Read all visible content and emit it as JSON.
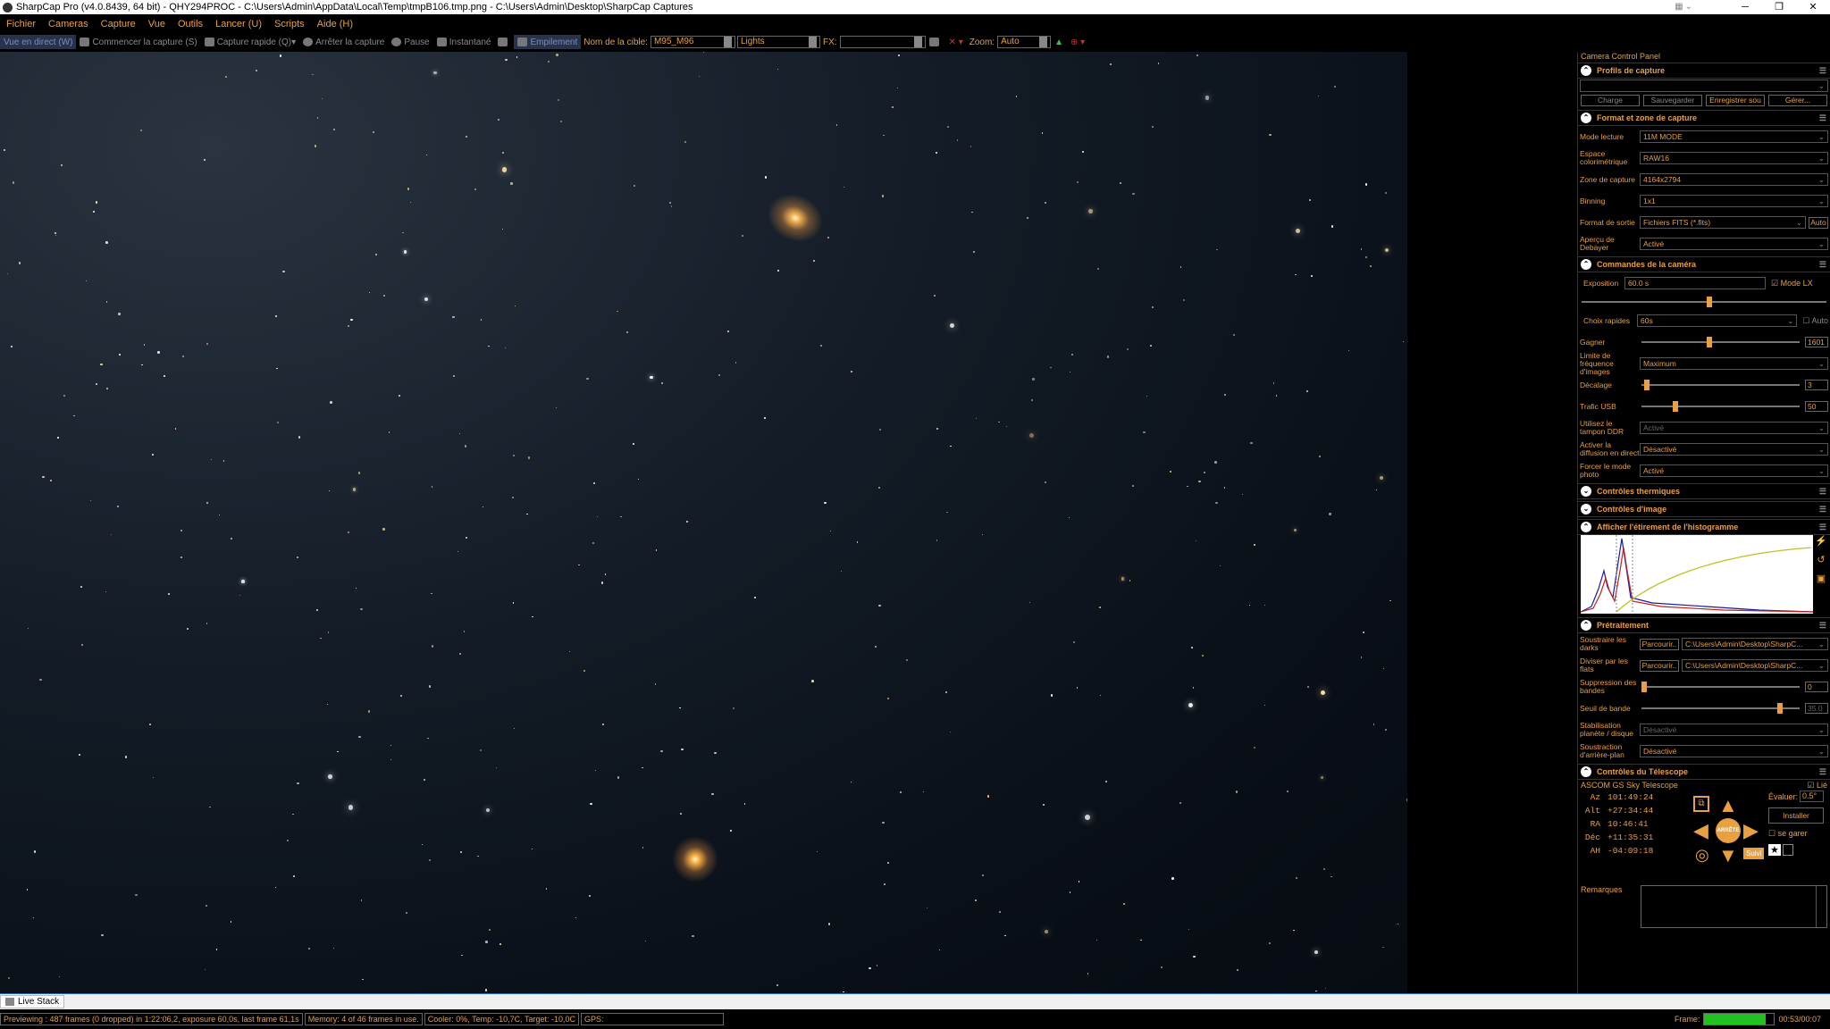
{
  "titlebar": {
    "title": "SharpCap Pro (v4.0.8439, 64 bit) - QHY294PROC - C:\\Users\\Admin\\AppData\\Local\\Temp\\tmpB106.tmp.png - C:\\Users\\Admin\\Desktop\\SharpCap Captures",
    "minimize": "─",
    "maximize": "❐",
    "close": "✕"
  },
  "menu": [
    "Fichier",
    "Cameras",
    "Capture",
    "Vue",
    "Outils",
    "Lancer (U)",
    "Scripts",
    "Aide (H)"
  ],
  "toolbar": {
    "live_view": "Vue en direct (W)",
    "start_capture": "Commencer la capture (S)",
    "quick_capture": "Capture rapide (Q)",
    "stop_capture": "Arrêter la capture",
    "pause": "Pause",
    "snapshot": "Instantané",
    "stacking": "Empilement",
    "target_label": "Nom de la cible:",
    "target_value": "M95_M96",
    "frame_type": "Lights",
    "fx_label": "FX:",
    "fx_value": "",
    "zoom_label": "Zoom:",
    "zoom_value": "Auto"
  },
  "panel": {
    "title": "Camera Control Panel",
    "sections": {
      "profiles": "Profils de capture",
      "format": "Format et zone de capture",
      "camera_controls": "Commandes de la caméra",
      "thermal": "Contrôles thermiques",
      "image": "Contrôles d'image",
      "histogram": "Afficher l'étirement de l'histogramme",
      "preprocessing": "Prétraitement",
      "telescope": "Contrôles du Télescope"
    },
    "profile_buttons": [
      "Charge",
      "Sauvegarder",
      "Enregistrer sou",
      "Gérer..."
    ],
    "format_rows": [
      {
        "label": "Mode lecture",
        "value": "11M MODE"
      },
      {
        "label": "Espace colorimétrique",
        "value": "RAW16"
      },
      {
        "label": "Zone de capture",
        "value": "4164x2794"
      },
      {
        "label": "Binning",
        "value": "1x1"
      },
      {
        "label": "Format de sortie",
        "value": "Fichiers FITS (*.fits)"
      },
      {
        "label": "Aperçu de Debayer",
        "value": "Activé"
      }
    ],
    "format_auto": "Auto",
    "exposure_label": "Exposition",
    "exposure_value": "60.0 s",
    "mode_lx": "Mode LX",
    "quick_choice_label": "Choix rapides",
    "quick_choice_value": "60s",
    "quick_auto": "Auto",
    "gain_label": "Gagner",
    "gain_value": "1601",
    "gain_level": 0.42,
    "fps_label": "Limite de fréquence d'images",
    "fps_value": "Maximum",
    "offset_label": "Décalage",
    "offset_value": "3",
    "offset_level": 0.02,
    "usb_label": "Trafic USB",
    "usb_value": "50",
    "usb_level": 0.2,
    "ddr_label": "Utilisez le tampon DDR",
    "ddr_value": "Activé",
    "broadcast_label": "Activer la diffusion en direct",
    "broadcast_value": "Désactivé",
    "photo_label": "Forcer le mode photo",
    "photo_value": "Activé",
    "darks_label": "Soustraire les darks",
    "flats_label": "Diviser par les flats",
    "browse": "Parcourir..",
    "darks_path": "C:\\Users\\Admin\\Desktop\\SharpC...",
    "flats_path": "C:\\Users\\Admin\\Desktop\\SharpC...",
    "banding_label": "Suppression des bandes",
    "banding_value": "0",
    "banding_level": 0.0,
    "band_thresh_label": "Seuil de bande",
    "band_thresh_value": "35.0",
    "band_thresh_level": 0.88,
    "stab_label": "Stabilisation planète / disque",
    "stab_value": "Désactivé",
    "bg_label": "Soustraction d'arrière-plan",
    "bg_value": "Désactivé",
    "scope_name": "ASCOM GS Sky Telescope",
    "scope_linked": "Lié",
    "coords": [
      {
        "k": "Az",
        "v": "101:49:24"
      },
      {
        "k": "Alt",
        "v": "+27:34:44"
      },
      {
        "k": "RA",
        "v": "10:46:41"
      },
      {
        "k": "Déc",
        "v": "+11:35:31"
      },
      {
        "k": "AH",
        "v": "-04:09:18"
      }
    ],
    "rate_label": "Évaluer:",
    "rate_value": "0.5°",
    "install": "Installer",
    "park": "se garer",
    "stop": "ARRÊTE",
    "follow": "Suivi",
    "notes_label": "Remarques"
  },
  "tabs": {
    "live_stack": "Live Stack"
  },
  "status": {
    "preview": "Previewing : 487 frames (0 dropped) in 1:22:06,2, exposure 60,0s, last frame 61,1s",
    "memory": "Memory: 4 of 46 frames in use.",
    "cooler": "Cooler: 0%, Temp: -10,7C, Target: -10,0C",
    "gps": "GPS:",
    "frame_label": "Frame:",
    "frame_progress": 0.88,
    "frame_time": "00:53/00:07"
  },
  "colors": {
    "accent": "#e8a040",
    "progress": "#22c122"
  }
}
